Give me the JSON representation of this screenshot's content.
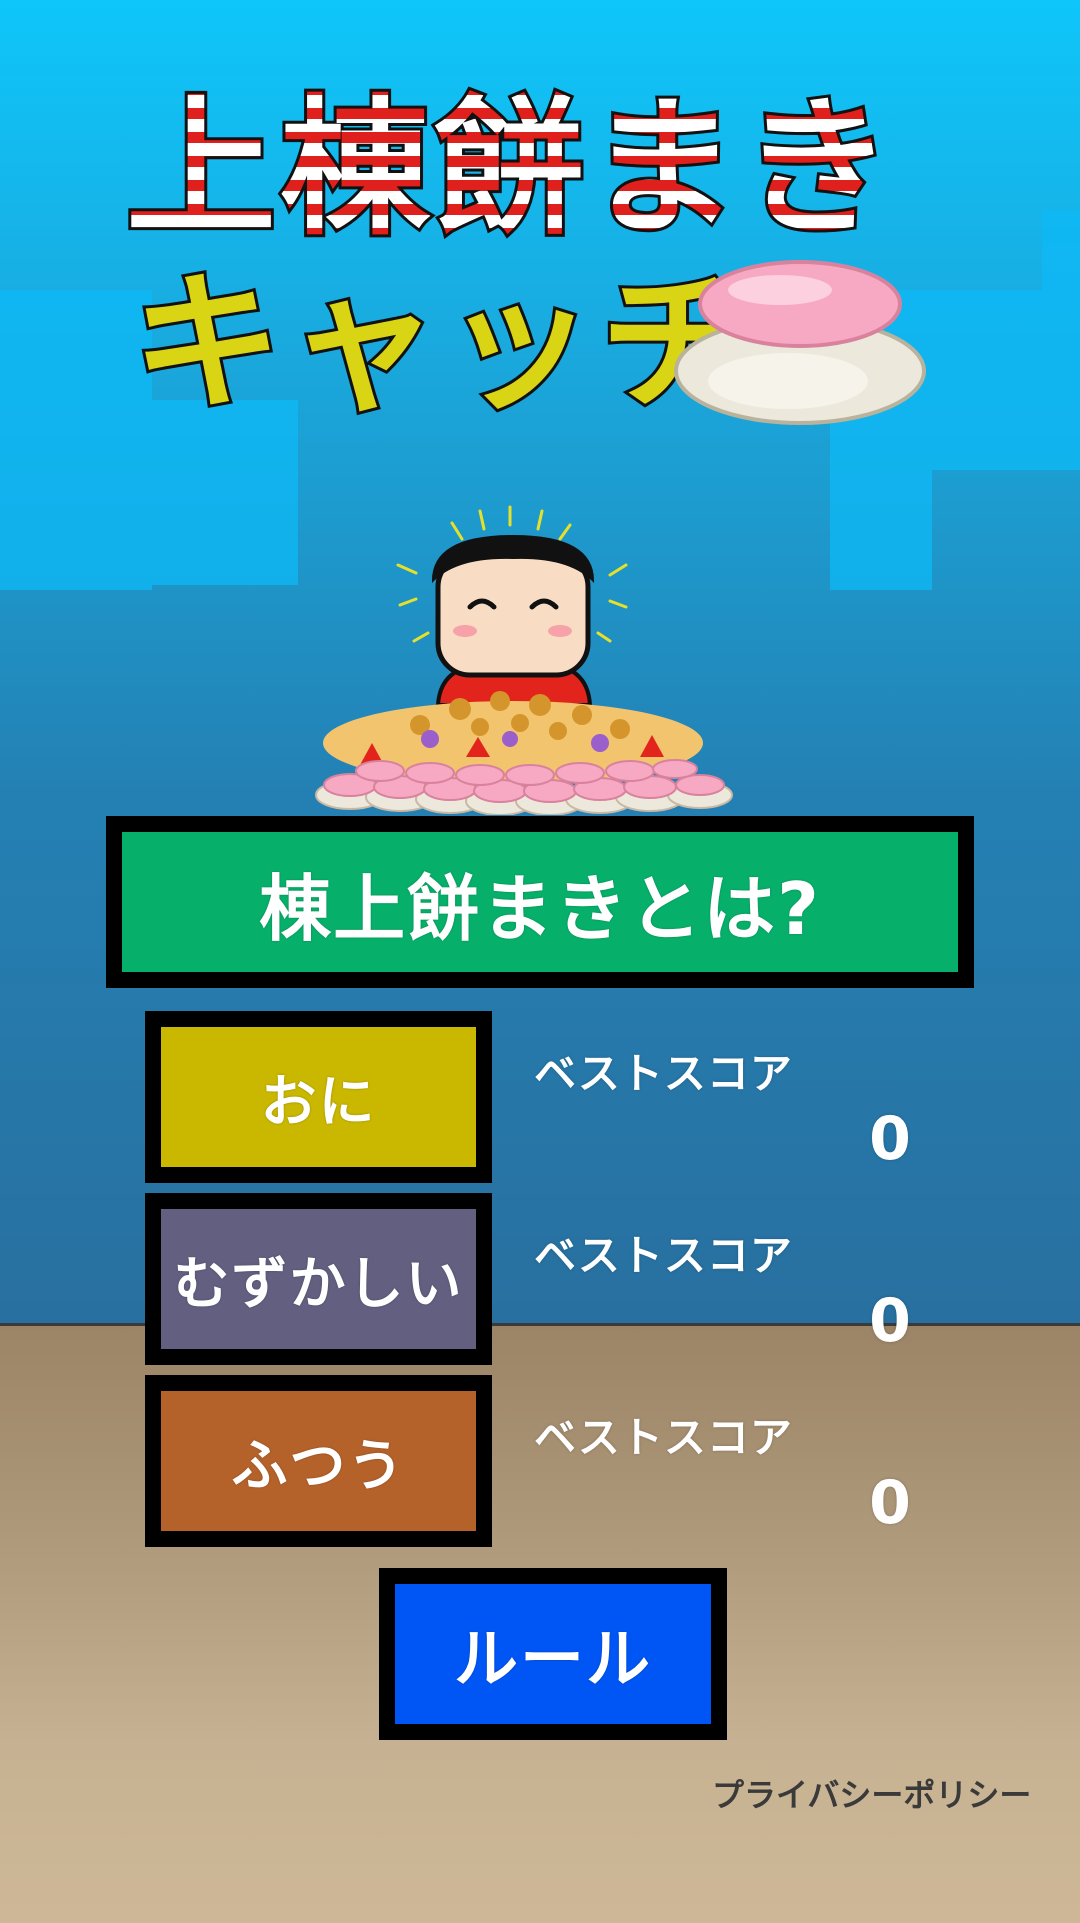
{
  "title": {
    "line1": "上棟餅まき",
    "line2": "キャッチ"
  },
  "menu": {
    "about_label": "棟上餅まきとは?",
    "rules_label": "ルール",
    "privacy_label": "プライバシーポリシー"
  },
  "modes": [
    {
      "label": "おに",
      "best_label": "ベストスコア",
      "best_score": "0",
      "color": "#c9b700"
    },
    {
      "label": "むずかしい",
      "best_label": "ベストスコア",
      "best_score": "0",
      "color": "#625f80"
    },
    {
      "label": "ふつう",
      "best_label": "ベストスコア",
      "best_score": "0",
      "color": "#b5622a"
    }
  ],
  "colors": {
    "about_button": "#07b06a",
    "rules_button": "#0056f5",
    "sky_top": "#0ec6fa",
    "ground": "#b19c7e"
  },
  "icons": [
    "mochi-icon",
    "mascot-boy-icon"
  ]
}
